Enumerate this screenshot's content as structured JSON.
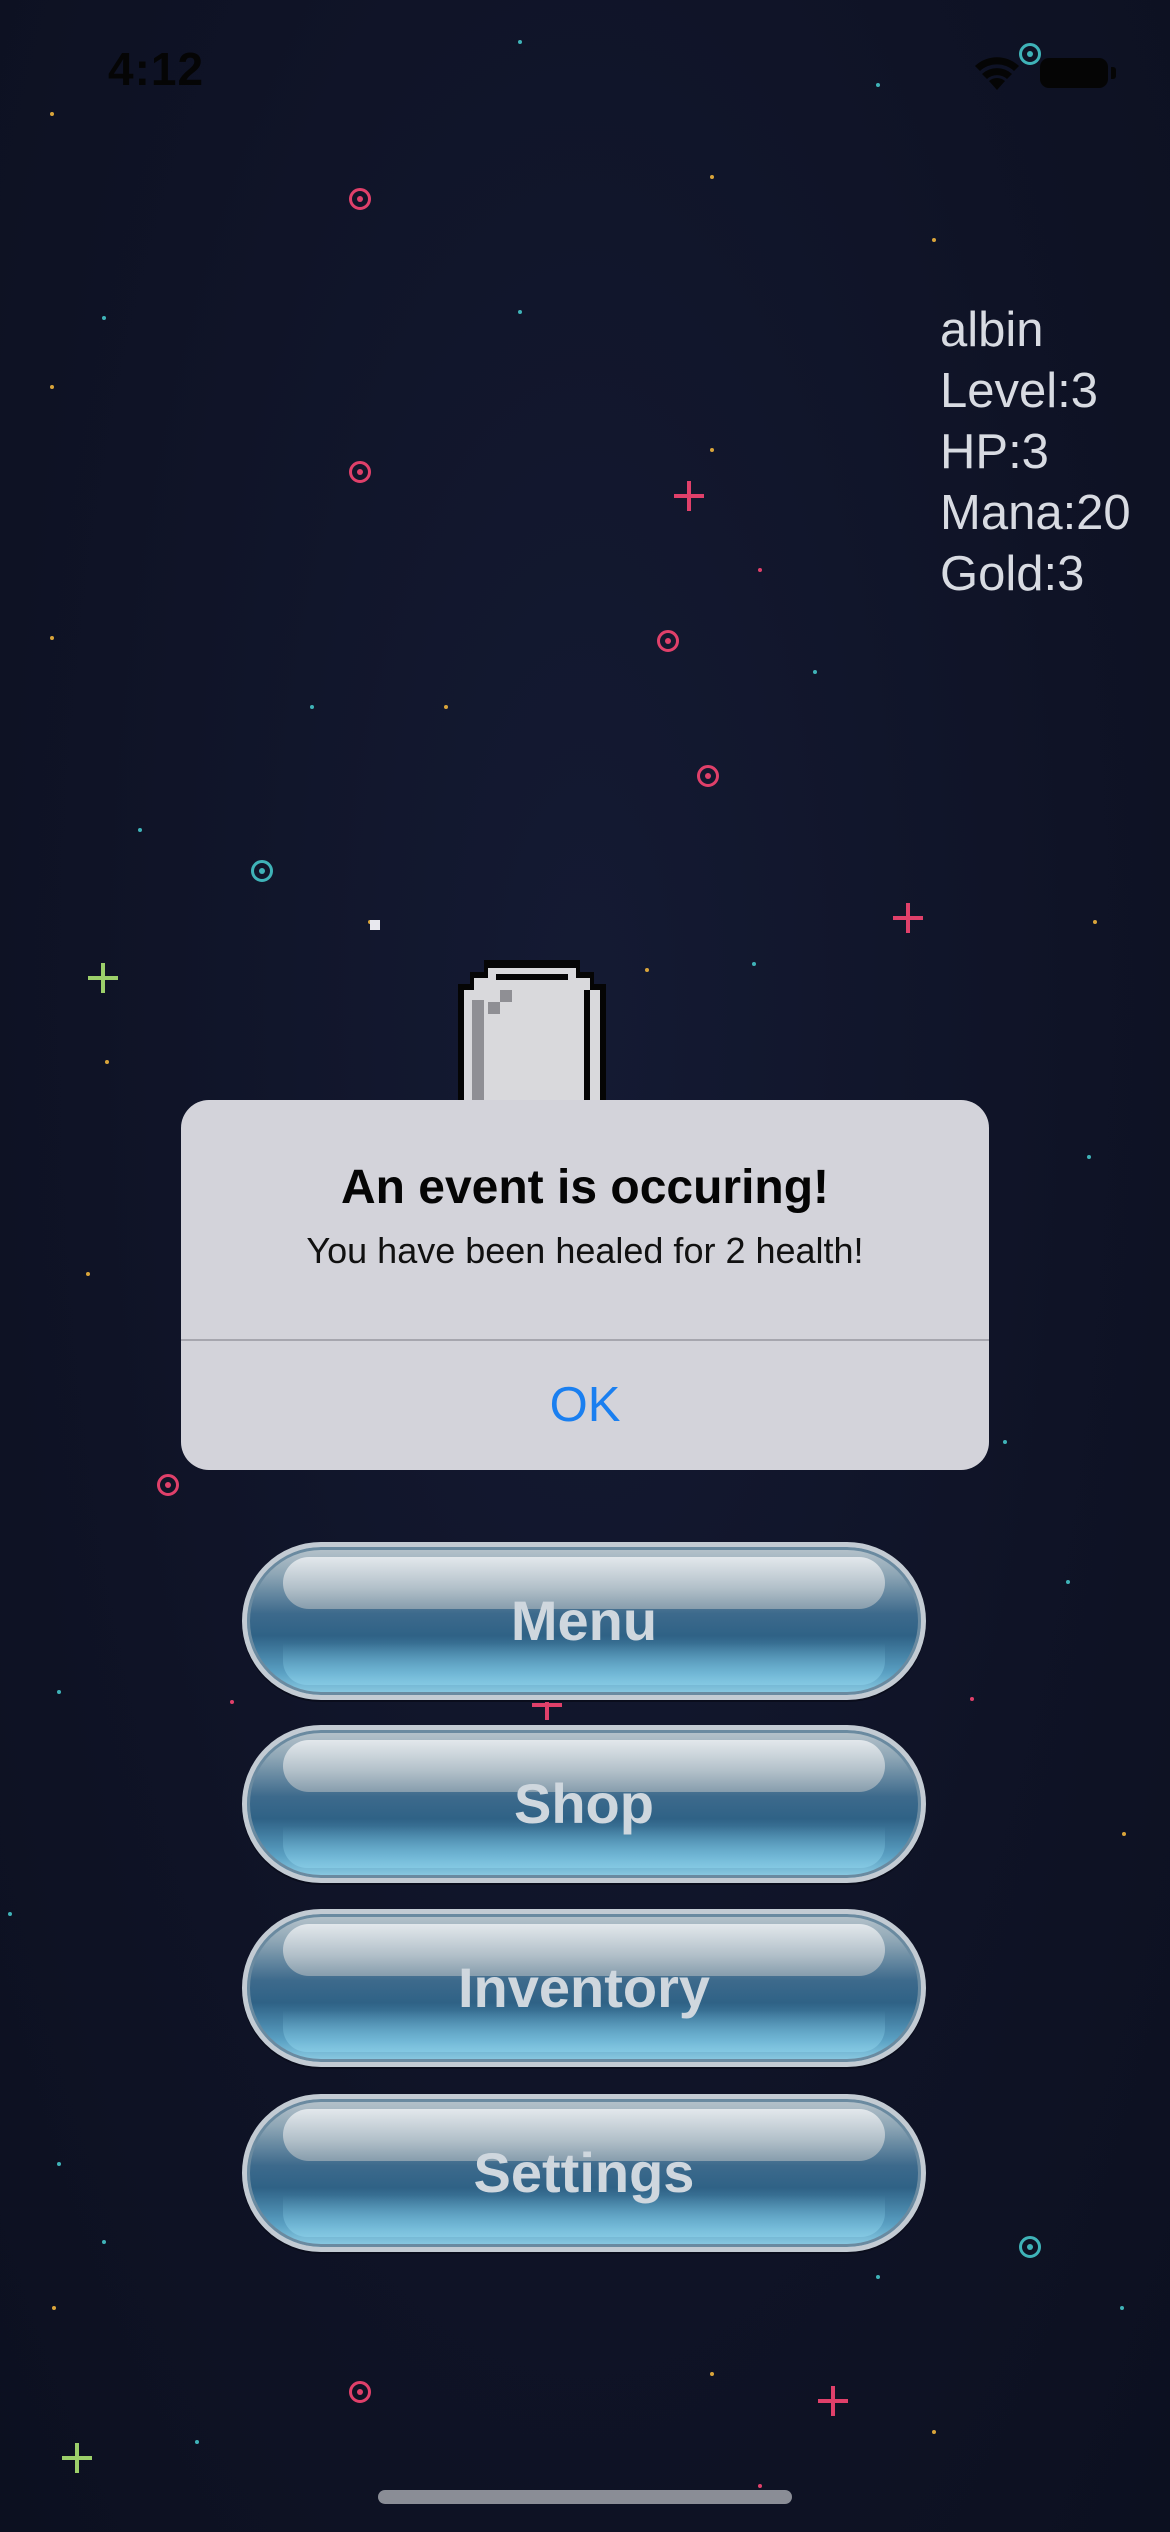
{
  "status_bar": {
    "time": "4:12"
  },
  "player": {
    "name": "albin",
    "level": "Level:3",
    "hp": "HP:3",
    "mana": "Mana:20",
    "gold": "Gold:3"
  },
  "alert": {
    "title": "An event is occuring!",
    "message": "You have been healed for 2 health!",
    "ok_label": "OK"
  },
  "menu": {
    "buttons": [
      {
        "label": "Menu"
      },
      {
        "label": "Shop"
      },
      {
        "label": "Inventory"
      },
      {
        "label": "Settings"
      }
    ]
  },
  "colors": {
    "background": "#101427",
    "alert_background": "#dadae0",
    "alert_button": "#1a7ff0",
    "button_top": "#b8c4cc",
    "button_bottom": "#8ecde4",
    "stats_text": "#d8dbe2",
    "star_pink": "#e0406a",
    "star_teal": "#3fb3b8",
    "star_gold": "#d9a43a",
    "star_green": "#9ccf6a"
  },
  "icons": {
    "wifi": "wifi-icon",
    "battery": "battery-icon",
    "sprite": "orb-sprite"
  }
}
